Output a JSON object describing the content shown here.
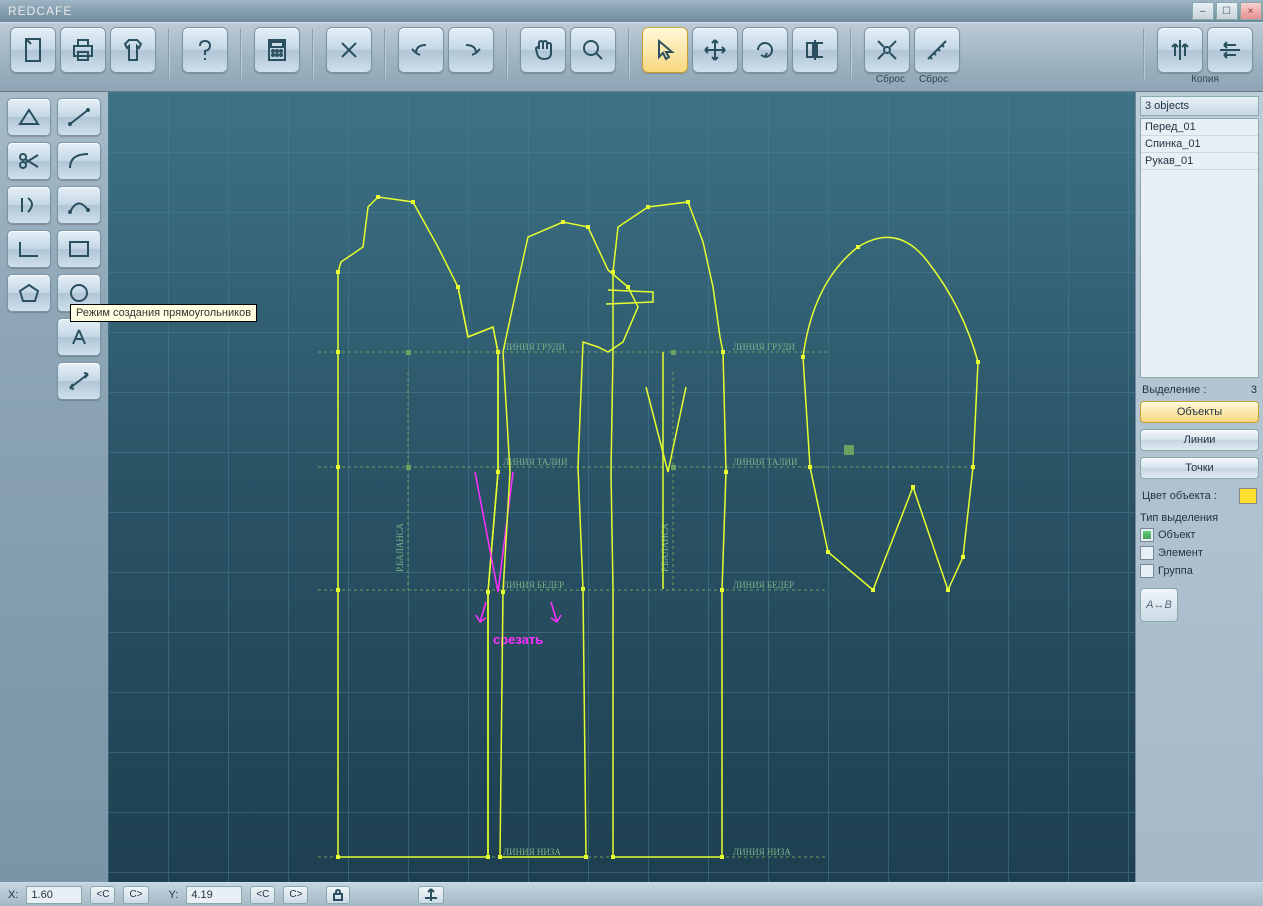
{
  "title": "REDCAFE",
  "toolbar": {
    "reset1": "Сброс",
    "reset2": "Сброс",
    "copy": "Копия"
  },
  "tooltip": "Режим создания прямоугольников",
  "right": {
    "objects_header": "3 objects",
    "list": [
      "Перед_01",
      "Спинка_01",
      "Рукав_01"
    ],
    "selection_label": "Выделение :",
    "selection_count": "3",
    "btn_objects": "Объекты",
    "btn_lines": "Линии",
    "btn_points": "Точки",
    "color_label": "Цвет объекта :",
    "seltype_label": "Тип выделения",
    "cb_object": "Объект",
    "cb_element": "Элемент",
    "cb_group": "Группа",
    "ab_label": "A↔B"
  },
  "status": {
    "x_label": "X:",
    "x_val": "1.60",
    "y_label": "Y:",
    "y_val": "4.19",
    "btn_c": "<C",
    "btn_c2": "C>"
  },
  "canvas": {
    "l_chest": "ЛИНИЯ  ГРУДИ",
    "l_waist": "ЛИНИЯ  ТАЛИИ",
    "l_hip": "ЛИНИЯ  БЕДЕР",
    "l_hem": "ЛИНИЯ  НИЗА",
    "l_balance": "Р.БАЛАНСА",
    "cut": "срезать"
  }
}
